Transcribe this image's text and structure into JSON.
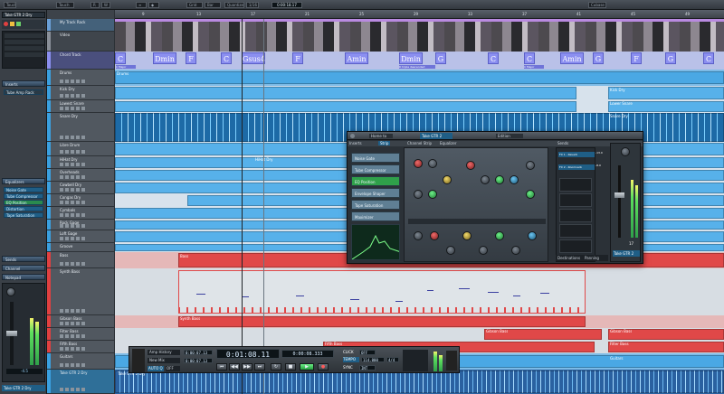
{
  "toolbar": {
    "items": [
      "Touch",
      "R",
      "W",
      "≡",
      "◆",
      "Grid",
      "Bar",
      "Quantize",
      "1/16",
      "Cubase"
    ],
    "time": "0:00:18.17"
  },
  "inspector": {
    "track_title": "Take GTR 2 Dry",
    "sections": [
      "Inserts",
      "Equalizers",
      "Sends",
      "Channel",
      "Notepad"
    ],
    "section_extra": "Chords",
    "inserts": [
      "Noise Gate",
      "Tube Compressor",
      "EQ Position",
      "Distortion",
      "Tape Saturation"
    ],
    "preset": "Tube Amp Rack",
    "fader_value": "-4.5",
    "bottom_label": "Take GTR 2 Dry"
  },
  "tracks": [
    {
      "name": "My Track Rack",
      "color": "#6aa0d8"
    },
    {
      "name": "Video",
      "color": "#8a9099"
    },
    {
      "name": "Chord Track",
      "color": "#8b8ff0"
    },
    {
      "name": "Drums",
      "color": "#3aa0e0"
    },
    {
      "name": "Kick Dry",
      "color": "#3aa0e0"
    },
    {
      "name": "Lowest Snare",
      "color": "#3aa0e0"
    },
    {
      "name": "Snare Dry",
      "color": "#3aa0e0"
    },
    {
      "name": "Hi-Hat",
      "color": "#3aa0e0"
    },
    {
      "name": "Claps",
      "color": "#3aa0e0"
    },
    {
      "name": "Libre Drum",
      "color": "#3aa0e0"
    },
    {
      "name": "HiHat Dry",
      "color": "#3aa0e0"
    },
    {
      "name": "Overheads",
      "color": "#3aa0e0"
    },
    {
      "name": "Cowbell Dry",
      "color": "#3aa0e0"
    },
    {
      "name": "Congas Dry",
      "color": "#3aa0e0"
    },
    {
      "name": "Cymbals",
      "color": "#3aa0e0"
    },
    {
      "name": "Rock Gage",
      "color": "#3aa0e0"
    },
    {
      "name": "Loft Gage",
      "color": "#3aa0e0"
    },
    {
      "name": "Groove",
      "color": "#3aa0e0"
    },
    {
      "name": "Bass",
      "color": "#e04040"
    },
    {
      "name": "Synth Bass",
      "color": "#e04040"
    },
    {
      "name": "Gibson Bass",
      "color": "#e04040"
    },
    {
      "name": "Filter Bass",
      "color": "#e04040"
    },
    {
      "name": "Fifth Bass",
      "color": "#e04040"
    },
    {
      "name": "Guitars",
      "color": "#3aa0e0"
    },
    {
      "name": "Take GTR 2 Dry",
      "color": "#3aa0e0"
    }
  ],
  "ruler": [
    "9",
    "13",
    "17",
    "21",
    "25",
    "29",
    "33",
    "37",
    "41",
    "45",
    "49"
  ],
  "chords": [
    {
      "label": "C",
      "sub": "C Major"
    },
    {
      "label": "Dmin",
      "sub": ""
    },
    {
      "label": "F",
      "sub": ""
    },
    {
      "label": "C",
      "sub": ""
    },
    {
      "label": "Gsus4",
      "sub": ""
    },
    {
      "label": "F",
      "sub": ""
    },
    {
      "label": "Amin",
      "sub": ""
    },
    {
      "label": "Dmin",
      "sub": "D triple descended"
    },
    {
      "label": "G",
      "sub": ""
    },
    {
      "label": "C",
      "sub": ""
    },
    {
      "label": "C",
      "sub": "C Major"
    },
    {
      "label": "Amin",
      "sub": ""
    },
    {
      "label": "G",
      "sub": ""
    },
    {
      "label": "F",
      "sub": ""
    },
    {
      "label": "G",
      "sub": ""
    },
    {
      "label": "C",
      "sub": ""
    }
  ],
  "arrange_labels": {
    "drums": "Drums",
    "kick": "Kick Dry",
    "lower_snare": "Lower Snare",
    "snare": "Snare Dry",
    "hihat": "HiHat Dry",
    "bass": "Bass",
    "synth_bass": "Synth Bass",
    "gibson": "Gibson Bass",
    "fifth": "Fifth Bass",
    "filter": "Filter Bass",
    "guitars": "Guitars",
    "take": "Take GTR 2 Dry"
  },
  "mixer": {
    "title": "Take GTR 2",
    "window_btns": [
      "Home to",
      "Take GTR 2",
      "Edition"
    ],
    "tabs": [
      "Inserts",
      "Strip",
      "Channel Strip",
      "Equalizer",
      "Sends"
    ],
    "strip_items": [
      "Noise Gate",
      "Tube Compressor",
      "EQ Position",
      "Envelope Shaper",
      "Tape Saturation",
      "Maximizer"
    ],
    "send_items": [
      "FX 1 - Reverb",
      "FX 2 - Roomverb"
    ],
    "send_values": [
      "-13.0",
      "-8.0"
    ],
    "footer": [
      "Destinations",
      "Panning"
    ],
    "channel_label": "Take GTR 2",
    "fader_value": "17"
  },
  "transport": {
    "project": "Amp History",
    "mode": "New Mix",
    "auto": "AUTO Q",
    "off": "OFF",
    "position_primary": "0:01:08.11",
    "position_secondary": "0:00:08.333",
    "left_locator": "0:00:07.13",
    "right_locator": "0:00:07.13",
    "click": "CLICK",
    "click_val": "OFF",
    "tempo": "TEMPO",
    "tempo_val": "114.000",
    "sync": "SYNC",
    "sync_val": "INT",
    "sig": "4/4",
    "buttons": [
      "⏮",
      "◀◀",
      "▶▶",
      "⏭",
      "↻",
      "■",
      "▶",
      "●"
    ]
  }
}
